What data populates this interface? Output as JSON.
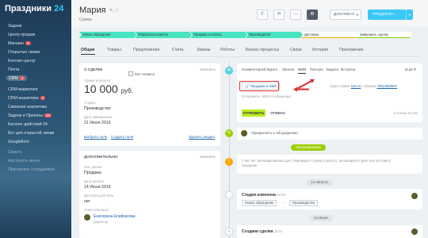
{
  "sidebar": {
    "brand": "Праздники",
    "brand_suffix": "24",
    "items": [
      {
        "label": "Задачи"
      },
      {
        "label": "Центр продаж"
      },
      {
        "label": "Магазин"
      },
      {
        "label": "Открытые линии"
      },
      {
        "label": "Контакт-центр"
      },
      {
        "label": "Почта"
      },
      {
        "label": "CRM"
      },
      {
        "label": "CRM-маркетинг"
      },
      {
        "label": "CRM-аналитика"
      },
      {
        "label": "Сквозная аналитика"
      },
      {
        "label": "Задачи и Проекты"
      },
      {
        "label": "Каталог действий 24"
      },
      {
        "label": "Бот для открытой линии"
      },
      {
        "label": "Googleform"
      },
      {
        "label": "Скрыть"
      },
      {
        "label": "Настроить меню"
      },
      {
        "label": "Пригласить сотрудников"
      }
    ],
    "badges": {
      "crm_new": "1",
      "tasks_new": "24",
      "markets_new": "1"
    }
  },
  "header": {
    "title": "Мария",
    "subtitle": "Сумма",
    "document_label": "ДОКУМЕНТ",
    "predoplata_label": "ПРЕДОПЛА..."
  },
  "stages": [
    {
      "label": "Новое обращение",
      "state": "done"
    },
    {
      "label": "Обработка клиента",
      "state": "done"
    },
    {
      "label": "Продажа и оплата",
      "state": "done"
    },
    {
      "label": "Производство",
      "state": "done"
    },
    {
      "label": "Доставка",
      "state": "todo-o"
    },
    {
      "label": "Завершить сделку",
      "state": "todo-g"
    }
  ],
  "tabs": [
    "Общие",
    "Товары",
    "Предложения",
    "Счета",
    "Заказы",
    "Роботы",
    "Бизнес-процессы",
    "Связи",
    "История",
    "Приложения"
  ],
  "about": {
    "heading": "О СДЕЛКЕ",
    "action": "изменить",
    "checkbox": "В24 сервиса",
    "amount_label": "Сумма и валюта",
    "amount": "10 000",
    "currency": "руб.",
    "stage_label": "Стадия",
    "stage_value": "Производство",
    "close_date_label": "Дата завершения",
    "close_date_value": "21 Июня 2019",
    "select_field": "Выбрать поле",
    "create_field": "Создать поле",
    "delete_section": "Удалить раздел"
  },
  "extra": {
    "heading": "ДОПОЛНИТЕЛЬНО",
    "action": "изменить",
    "type_label": "Тип сделки",
    "type_value": "Продажа",
    "start_label": "Дата начала",
    "start_value": "14 Июня 2019",
    "available_label": "Доступна для всех",
    "available_value": "нет",
    "responsible_label": "Ответственный",
    "responsible_name": "Екатерина Епифанова",
    "responsible_role": "директор"
  },
  "composer": {
    "tabs": [
      "Комментарий",
      "Ждать",
      "Звонок",
      "SMS",
      "Письмо",
      "Задача",
      "Встреча",
      "Ещё"
    ],
    "active_tab": "SMS",
    "sms_button": "Продажи в SMS",
    "via_text": "через сервис",
    "service": "sms.ru",
    "to_number_text": "с номера",
    "number": "79014583097",
    "placeholder": "Отправить SMS сообщение",
    "send": "ОТПРАВИТЬ",
    "cancel": "ОТМЕНА",
    "counter": "0 знаков из 200"
  },
  "timeline": {
    "discussion": "Прикрепить к обсуждению",
    "planned": "Запланировано",
    "planned_text": "У вас нет запланированных дел. Переведите сделку в работу, запланируйте дела или поставьте ожидание.",
    "date1": "14 Августа",
    "stage_changed_title": "Стадия изменена",
    "stage_changed_time": "10:06",
    "from_stage": "Новое обращение",
    "to_stage": "Производство",
    "date2": "14 Июня",
    "created_title": "Создана сделка",
    "created_time": "10:01"
  }
}
